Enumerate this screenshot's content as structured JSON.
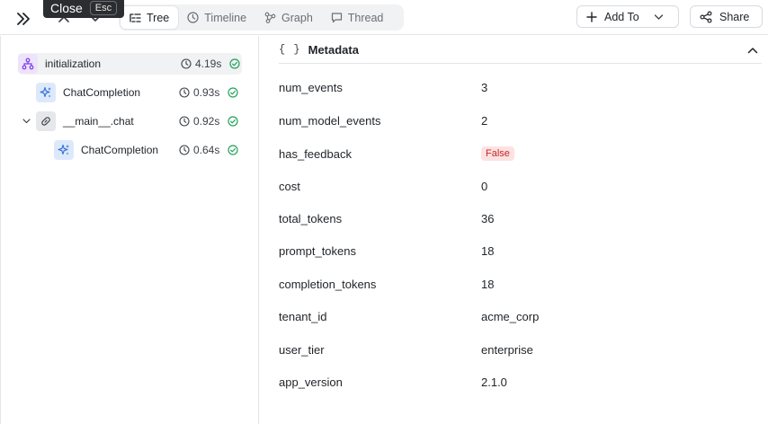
{
  "tooltip": {
    "label": "Close",
    "shortcut": "Esc"
  },
  "tabs": [
    {
      "label": "Tree",
      "icon": "tree-list-icon",
      "active": true
    },
    {
      "label": "Timeline",
      "icon": "clock-icon",
      "active": false
    },
    {
      "label": "Graph",
      "icon": "graph-icon",
      "active": false
    },
    {
      "label": "Thread",
      "icon": "chat-bubble-icon",
      "active": false
    }
  ],
  "toolbar": {
    "add_to_label": "Add To",
    "share_label": "Share"
  },
  "tree": [
    {
      "label": "initialization",
      "duration": "4.19s",
      "icon": "hierarchy-icon",
      "status": "success",
      "selected": true
    },
    {
      "label": "ChatCompletion",
      "duration": "0.93s",
      "icon": "sparkle-icon",
      "status": "success"
    },
    {
      "label": "__main__.chat",
      "duration": "0.92s",
      "icon": "link-icon",
      "status": "success",
      "expanded": true
    },
    {
      "label": "ChatCompletion",
      "duration": "0.64s",
      "icon": "sparkle-icon",
      "status": "success"
    }
  ],
  "metadata": {
    "braces": "{ }",
    "title": "Metadata",
    "rows": [
      {
        "key": "num_events",
        "value": "3"
      },
      {
        "key": "num_model_events",
        "value": "2"
      },
      {
        "key": "has_feedback",
        "value": "False"
      },
      {
        "key": "cost",
        "value": "0"
      },
      {
        "key": "total_tokens",
        "value": "36"
      },
      {
        "key": "prompt_tokens",
        "value": "18"
      },
      {
        "key": "completion_tokens",
        "value": "18"
      },
      {
        "key": "tenant_id",
        "value": "acme_corp"
      },
      {
        "key": "user_tier",
        "value": "enterprise"
      },
      {
        "key": "app_version",
        "value": "2.1.0"
      }
    ]
  },
  "colors": {
    "success": "#22a35a",
    "false_badge_bg": "#fde2e2",
    "false_badge_text": "#c62828",
    "accent_purple": "#7c3aed",
    "accent_blue": "#2f6fd6"
  }
}
